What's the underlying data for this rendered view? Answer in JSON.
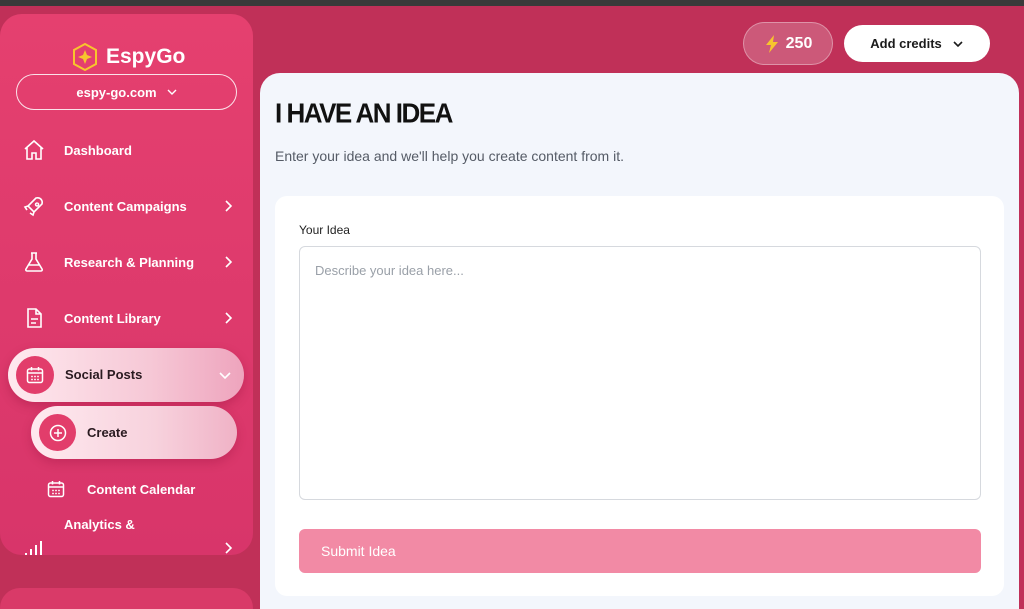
{
  "app": {
    "name": "EspyGo"
  },
  "site_selector": {
    "value": "espy-go.com"
  },
  "sidebar": {
    "items": [
      {
        "label": "Dashboard",
        "icon": "home-icon"
      },
      {
        "label": "Content Campaigns",
        "icon": "rocket-icon"
      },
      {
        "label": "Research & Planning",
        "icon": "flask-icon"
      },
      {
        "label": "Content Library",
        "icon": "document-icon"
      },
      {
        "label": "Social Posts",
        "icon": "calendar-icon"
      },
      {
        "label": "Analytics &",
        "icon": "bar-chart-icon"
      }
    ],
    "sub_items": [
      {
        "label": "Create",
        "icon": "plus-circle-icon"
      },
      {
        "label": "Content Calendar",
        "icon": "calendar-icon"
      }
    ]
  },
  "header": {
    "credits": "250",
    "add_credits_label": "Add credits"
  },
  "main": {
    "title": "I HAVE AN IDEA",
    "subtitle": "Enter your idea and we'll help you create content from it.",
    "field_label": "Your Idea",
    "placeholder": "Describe your idea here...",
    "submit_label": "Submit Idea"
  },
  "colors": {
    "brand": "#e23d6b",
    "background": "#c03058",
    "submit": "#f28aa5",
    "logo_accent": "#f7c52d"
  }
}
